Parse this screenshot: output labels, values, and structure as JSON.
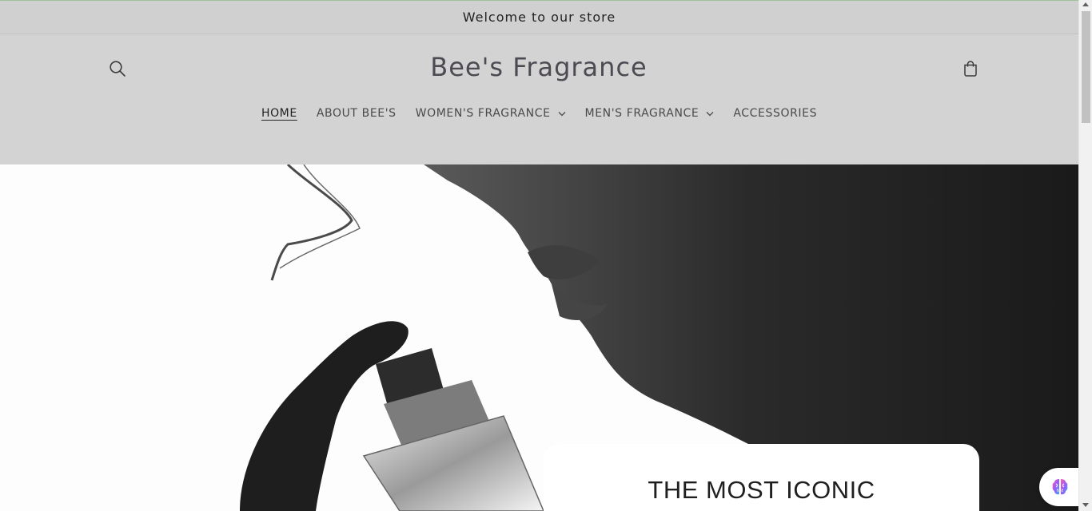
{
  "announcement": {
    "text": "Welcome to our store"
  },
  "header": {
    "brand": "Bee's Fragrance",
    "search_icon": "search-icon",
    "cart_icon": "cart-icon"
  },
  "nav": {
    "items": [
      {
        "label": "HOME",
        "active": true,
        "dropdown": false
      },
      {
        "label": "ABOUT BEE'S",
        "active": false,
        "dropdown": false
      },
      {
        "label": "WOMEN'S FRAGRANCE",
        "active": false,
        "dropdown": true
      },
      {
        "label": "MEN'S FRAGRANCE",
        "active": false,
        "dropdown": true
      },
      {
        "label": "ACCESSORIES",
        "active": false,
        "dropdown": false
      }
    ]
  },
  "hero": {
    "title": "THE MOST ICONIC"
  },
  "widget": {
    "icon": "brain-icon"
  },
  "colors": {
    "header_bg": "#d3d3d3",
    "announcement_bg": "#d0d0d0",
    "brand_text": "#4d4a52"
  }
}
